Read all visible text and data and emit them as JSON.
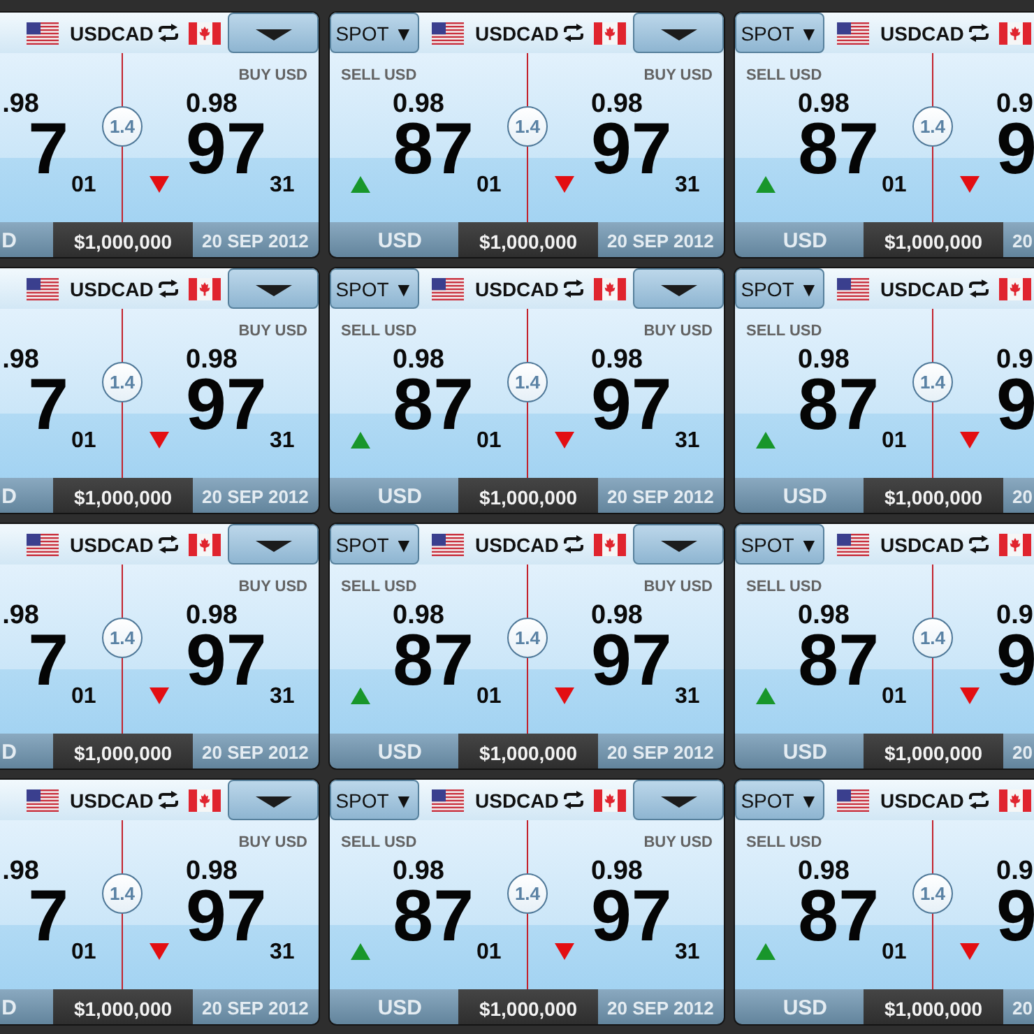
{
  "rows": [
    {
      "tiles": [
        {
          "pair": "USDCAD",
          "menu_button": true,
          "sell": {
            "big_figure": ".98",
            "pips": "7",
            "fractional_pips": "01"
          },
          "spread": "1.4",
          "buy": {
            "label": "BUY USD",
            "rising": false,
            "big_figure": "0.98",
            "pips": "97",
            "fractional_pips": "31"
          },
          "footer": {
            "currency": "D",
            "amount": "$1,000,000",
            "date": "20 SEP 2012"
          }
        },
        {
          "spot_button": "SPOT ▼",
          "pair": "USDCAD",
          "menu_button": true,
          "sell": {
            "label": "SELL USD",
            "rising": true,
            "big_figure": "0.98",
            "pips": "87",
            "fractional_pips": "01"
          },
          "spread": "1.4",
          "buy": {
            "label": "BUY USD",
            "rising": false,
            "big_figure": "0.98",
            "pips": "97",
            "fractional_pips": "31"
          },
          "footer": {
            "currency": "USD",
            "amount": "$1,000,000",
            "date": "20 SEP 2012"
          }
        },
        {
          "spot_button": "SPOT ▼",
          "pair": "USDCAD",
          "sell": {
            "label": "SELL USD",
            "rising": true,
            "big_figure": "0.98",
            "pips": "87",
            "fractional_pips": "01"
          },
          "spread": "1.4",
          "buy": {
            "rising": false,
            "big_figure": "0.9",
            "pips": "9"
          },
          "footer": {
            "currency": "USD",
            "amount": "$1,000,000",
            "date": "20"
          }
        }
      ]
    },
    {
      "tiles": [
        {
          "pair": "USDCAD",
          "menu_button": true,
          "sell": {
            "big_figure": ".98",
            "pips": "7",
            "fractional_pips": "01"
          },
          "spread": "1.4",
          "buy": {
            "label": "BUY USD",
            "rising": false,
            "big_figure": "0.98",
            "pips": "97",
            "fractional_pips": "31"
          },
          "footer": {
            "currency": "D",
            "amount": "$1,000,000",
            "date": "20 SEP 2012"
          }
        },
        {
          "spot_button": "SPOT ▼",
          "pair": "USDCAD",
          "menu_button": true,
          "sell": {
            "label": "SELL USD",
            "rising": true,
            "big_figure": "0.98",
            "pips": "87",
            "fractional_pips": "01"
          },
          "spread": "1.4",
          "buy": {
            "label": "BUY USD",
            "rising": false,
            "big_figure": "0.98",
            "pips": "97",
            "fractional_pips": "31"
          },
          "footer": {
            "currency": "USD",
            "amount": "$1,000,000",
            "date": "20 SEP 2012"
          }
        },
        {
          "spot_button": "SPOT ▼",
          "pair": "USDCAD",
          "sell": {
            "label": "SELL USD",
            "rising": true,
            "big_figure": "0.98",
            "pips": "87",
            "fractional_pips": "01"
          },
          "spread": "1.4",
          "buy": {
            "rising": false,
            "big_figure": "0.9",
            "pips": "9"
          },
          "footer": {
            "currency": "USD",
            "amount": "$1,000,000",
            "date": "20"
          }
        }
      ]
    },
    {
      "tiles": [
        {
          "pair": "USDCAD",
          "menu_button": true,
          "sell": {
            "big_figure": ".98",
            "pips": "7",
            "fractional_pips": "01"
          },
          "spread": "1.4",
          "buy": {
            "label": "BUY USD",
            "rising": false,
            "big_figure": "0.98",
            "pips": "97",
            "fractional_pips": "31"
          },
          "footer": {
            "currency": "D",
            "amount": "$1,000,000",
            "date": "20 SEP 2012"
          }
        },
        {
          "spot_button": "SPOT ▼",
          "pair": "USDCAD",
          "menu_button": true,
          "sell": {
            "label": "SELL USD",
            "rising": true,
            "big_figure": "0.98",
            "pips": "87",
            "fractional_pips": "01"
          },
          "spread": "1.4",
          "buy": {
            "label": "BUY USD",
            "rising": false,
            "big_figure": "0.98",
            "pips": "97",
            "fractional_pips": "31"
          },
          "footer": {
            "currency": "USD",
            "amount": "$1,000,000",
            "date": "20 SEP 2012"
          }
        },
        {
          "spot_button": "SPOT ▼",
          "pair": "USDCAD",
          "sell": {
            "label": "SELL USD",
            "rising": true,
            "big_figure": "0.98",
            "pips": "87",
            "fractional_pips": "01"
          },
          "spread": "1.4",
          "buy": {
            "rising": false,
            "big_figure": "0.9",
            "pips": "9"
          },
          "footer": {
            "currency": "USD",
            "amount": "$1,000,000",
            "date": "20"
          }
        }
      ]
    },
    {
      "tiles": [
        {
          "pair": "USDCAD",
          "menu_button": true,
          "sell": {
            "big_figure": ".98",
            "pips": "7",
            "fractional_pips": "01"
          },
          "spread": "1.4",
          "buy": {
            "label": "BUY USD",
            "rising": false,
            "big_figure": "0.98",
            "pips": "97",
            "fractional_pips": "31"
          },
          "footer": {
            "currency": "D",
            "amount": "$1,000,000",
            "date": "20 SEP 2012"
          }
        },
        {
          "spot_button": "SPOT ▼",
          "pair": "USDCAD",
          "menu_button": true,
          "sell": {
            "label": "SELL USD",
            "rising": true,
            "big_figure": "0.98",
            "pips": "87",
            "fractional_pips": "01"
          },
          "spread": "1.4",
          "buy": {
            "label": "BUY USD",
            "rising": false,
            "big_figure": "0.98",
            "pips": "97",
            "fractional_pips": "31"
          },
          "footer": {
            "currency": "USD",
            "amount": "$1,000,000",
            "date": "20 SEP 2012"
          }
        },
        {
          "spot_button": "SPOT ▼",
          "pair": "USDCAD",
          "sell": {
            "label": "SELL USD",
            "rising": true,
            "big_figure": "0.98",
            "pips": "87",
            "fractional_pips": "01"
          },
          "spread": "1.4",
          "buy": {
            "rising": false,
            "big_figure": "0.9",
            "pips": "9"
          },
          "footer": {
            "currency": "USD",
            "amount": "$1,000,000",
            "date": "20"
          }
        }
      ]
    }
  ]
}
